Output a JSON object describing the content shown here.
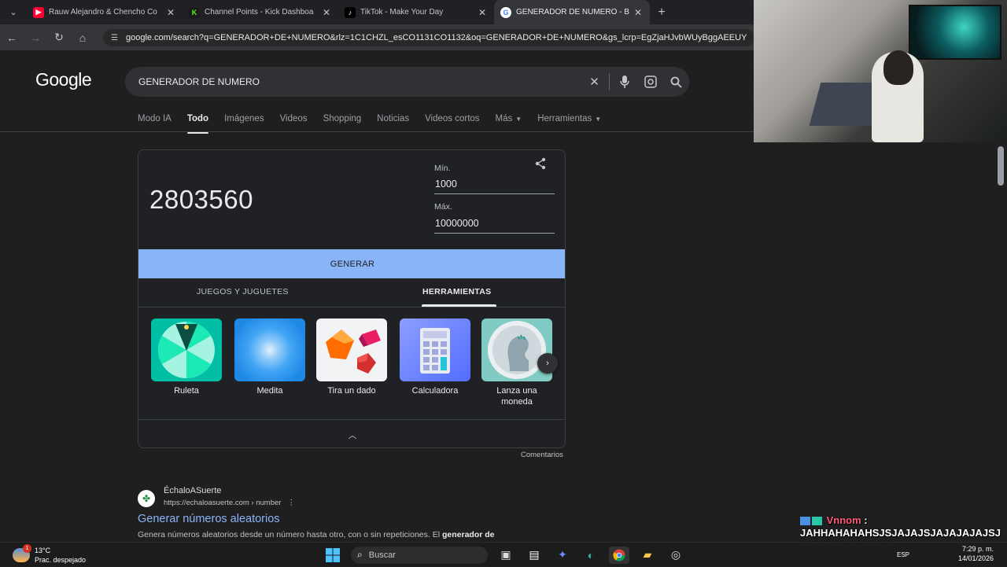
{
  "browser": {
    "tabs": [
      {
        "title": "Rauw Alejandro & Chencho Co",
        "icon": "youtube-icon",
        "color": "#ff0033"
      },
      {
        "title": "Channel Points - Kick Dashboa",
        "icon": "kick-icon",
        "color": "#53fc18"
      },
      {
        "title": "TikTok - Make Your Day",
        "icon": "tiktok-icon",
        "color": "#000000"
      },
      {
        "title": "GENERADOR DE NUMERO - Bu",
        "icon": "google-icon",
        "color": "#4285f4"
      }
    ],
    "url": "google.com/search?q=GENERADOR+DE+NUMERO&rlz=1C1CHZL_esCO1131CO1132&oq=GENERADOR+DE+NUMERO&gs_lcrp=EgZjaHJvbWUyBggAEEUY"
  },
  "google": {
    "logo": "Google",
    "query": "GENERADOR DE NUMERO",
    "nav": [
      {
        "label": "Modo IA",
        "selected": false
      },
      {
        "label": "Todo",
        "selected": true
      },
      {
        "label": "Imágenes",
        "selected": false
      },
      {
        "label": "Videos",
        "selected": false
      },
      {
        "label": "Shopping",
        "selected": false
      },
      {
        "label": "Noticias",
        "selected": false
      },
      {
        "label": "Videos cortos",
        "selected": false
      },
      {
        "label": "Más",
        "selected": false
      },
      {
        "label": "Herramientas",
        "selected": false
      }
    ]
  },
  "generator": {
    "result": "2803560",
    "min_label": "Mín.",
    "min_value": "1000",
    "max_label": "Máx.",
    "max_value": "10000000",
    "button": "GENERAR",
    "tabs": [
      "JUEGOS Y JUGUETES",
      "HERRAMIENTAS"
    ],
    "selected_tab": "HERRAMIENTAS",
    "tools": [
      {
        "label": "Ruleta",
        "icon": "roulette-icon"
      },
      {
        "label": "Medita",
        "icon": "meditate-icon"
      },
      {
        "label": "Tira un dado",
        "icon": "dice-icon"
      },
      {
        "label": "Calculadora",
        "icon": "calculator-icon"
      },
      {
        "label": "Lanza una moneda",
        "icon": "coin-icon"
      }
    ],
    "feedback": "Comentarios"
  },
  "result": {
    "site": "ÉchaloASuerte",
    "url": "https://echaloasuerte.com › number",
    "title": "Generar números aleatorios",
    "snippet_prefix": "Genera números aleatorios desde un número hasta otro, con o sin repeticiones. El ",
    "snippet_bold": "generador de"
  },
  "chat": {
    "user": "Vnnom",
    "message": "JAHHAHAHAHSJSJAJAJSJAJAJAJAJSJAJSJSJAAHAHAHA"
  },
  "taskbar": {
    "temperature": "13°C",
    "weather": "Prac. despejado",
    "weather_badge": "1",
    "search_placeholder": "Buscar",
    "language": "ESP",
    "time": "7:29 p. m.",
    "date": "14/01/2026"
  }
}
